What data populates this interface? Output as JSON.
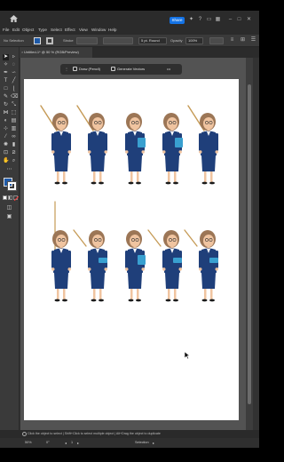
{
  "titlebar": {
    "share_label": "Share",
    "icons": [
      "home-icon",
      "tips-icon",
      "help-icon",
      "arrange-icon",
      "grid-icon",
      "minimize-icon",
      "maximize-icon",
      "close-icon"
    ]
  },
  "menu": {
    "items": [
      "File",
      "Edit",
      "Object",
      "Type",
      "Select",
      "Effect",
      "View",
      "Window",
      "Help"
    ]
  },
  "control": {
    "selection_label": "No Selection",
    "stroke_label": "Stroke",
    "brush_label": "5 pt. Round",
    "opacity_label": "Opacity",
    "opacity_value": "100%",
    "fill_color": "#1e5aa8"
  },
  "document": {
    "tab_title": "Untitled-1* @ 50 % (RGB/Preview)"
  },
  "contextual_task_bar": {
    "draw_label": "Draw (Pencil)",
    "generate_label": "Generate Vectors",
    "more_label": "•••"
  },
  "artboard": {
    "figures": [
      {
        "row": 1,
        "pose": "pointer-raised-left"
      },
      {
        "row": 1,
        "pose": "pointer-raised-left"
      },
      {
        "row": 1,
        "pose": "holding-folder"
      },
      {
        "row": 1,
        "pose": "holding-folder"
      },
      {
        "row": 1,
        "pose": "pointer-raised-left"
      },
      {
        "row": 2,
        "pose": "pointer-diagonal"
      },
      {
        "row": 2,
        "pose": "pointer-arm-out"
      },
      {
        "row": 2,
        "pose": "holding-folder"
      },
      {
        "row": 2,
        "pose": "pointer-arm-out"
      },
      {
        "row": 2,
        "pose": "pointer-arm-out"
      }
    ],
    "palette": {
      "hair": "#9c7656",
      "skin": "#f0c4a0",
      "suit": "#1f3f7a",
      "folder": "#39a0d0",
      "pointer": "#c59a55"
    }
  },
  "hint": {
    "text": "Click the object to select  |  Shift+Click to select multiple object  |  Alt+Drag the object to duplicate"
  },
  "status": {
    "zoom": "50%",
    "angle": "0°",
    "artboard_number": "1",
    "tool_name": "Selection"
  }
}
